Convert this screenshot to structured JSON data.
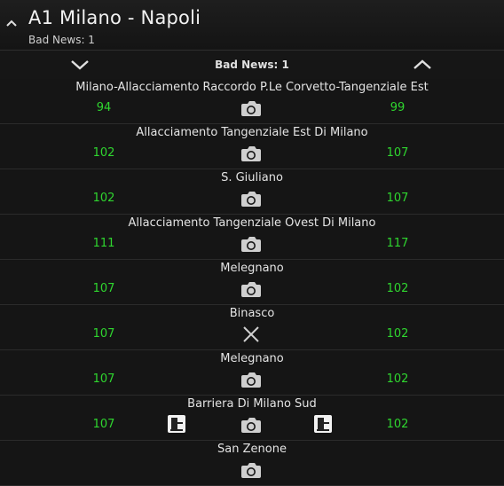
{
  "header": {
    "title": "A1 Milano - Napoli",
    "subtitle": "Bad News: 1"
  },
  "navbar": {
    "label": "Bad News: 1"
  },
  "rows": [
    {
      "name": "Milano-Allacciamento Raccordo P.Le Corvetto-Tangenziale Est",
      "left": "94",
      "right": "99",
      "icon": "camera-icon"
    },
    {
      "name": "Allacciamento Tangenziale Est Di Milano",
      "left": "102",
      "right": "107",
      "icon": "camera-icon"
    },
    {
      "name": "S. Giuliano",
      "left": "102",
      "right": "107",
      "icon": "camera-icon"
    },
    {
      "name": "Allacciamento Tangenziale Ovest Di Milano",
      "left": "111",
      "right": "117",
      "icon": "camera-icon"
    },
    {
      "name": "Melegnano",
      "left": "107",
      "right": "102",
      "icon": "camera-icon"
    },
    {
      "name": "Binasco",
      "left": "107",
      "right": "102",
      "icon": "close-x-icon"
    },
    {
      "name": "Melegnano",
      "left": "107",
      "right": "102",
      "icon": "camera-icon"
    },
    {
      "name": "Barriera Di Milano Sud",
      "left": "107",
      "right": "102",
      "icon": "camera-icon",
      "side_icons": "toll-booth-icon"
    },
    {
      "name": "San Zenone",
      "left": "",
      "right": "",
      "icon": "camera-icon"
    }
  ],
  "colors": {
    "background": "#141414",
    "time_green": "#2fd62f",
    "text": "#e4e4e4"
  }
}
